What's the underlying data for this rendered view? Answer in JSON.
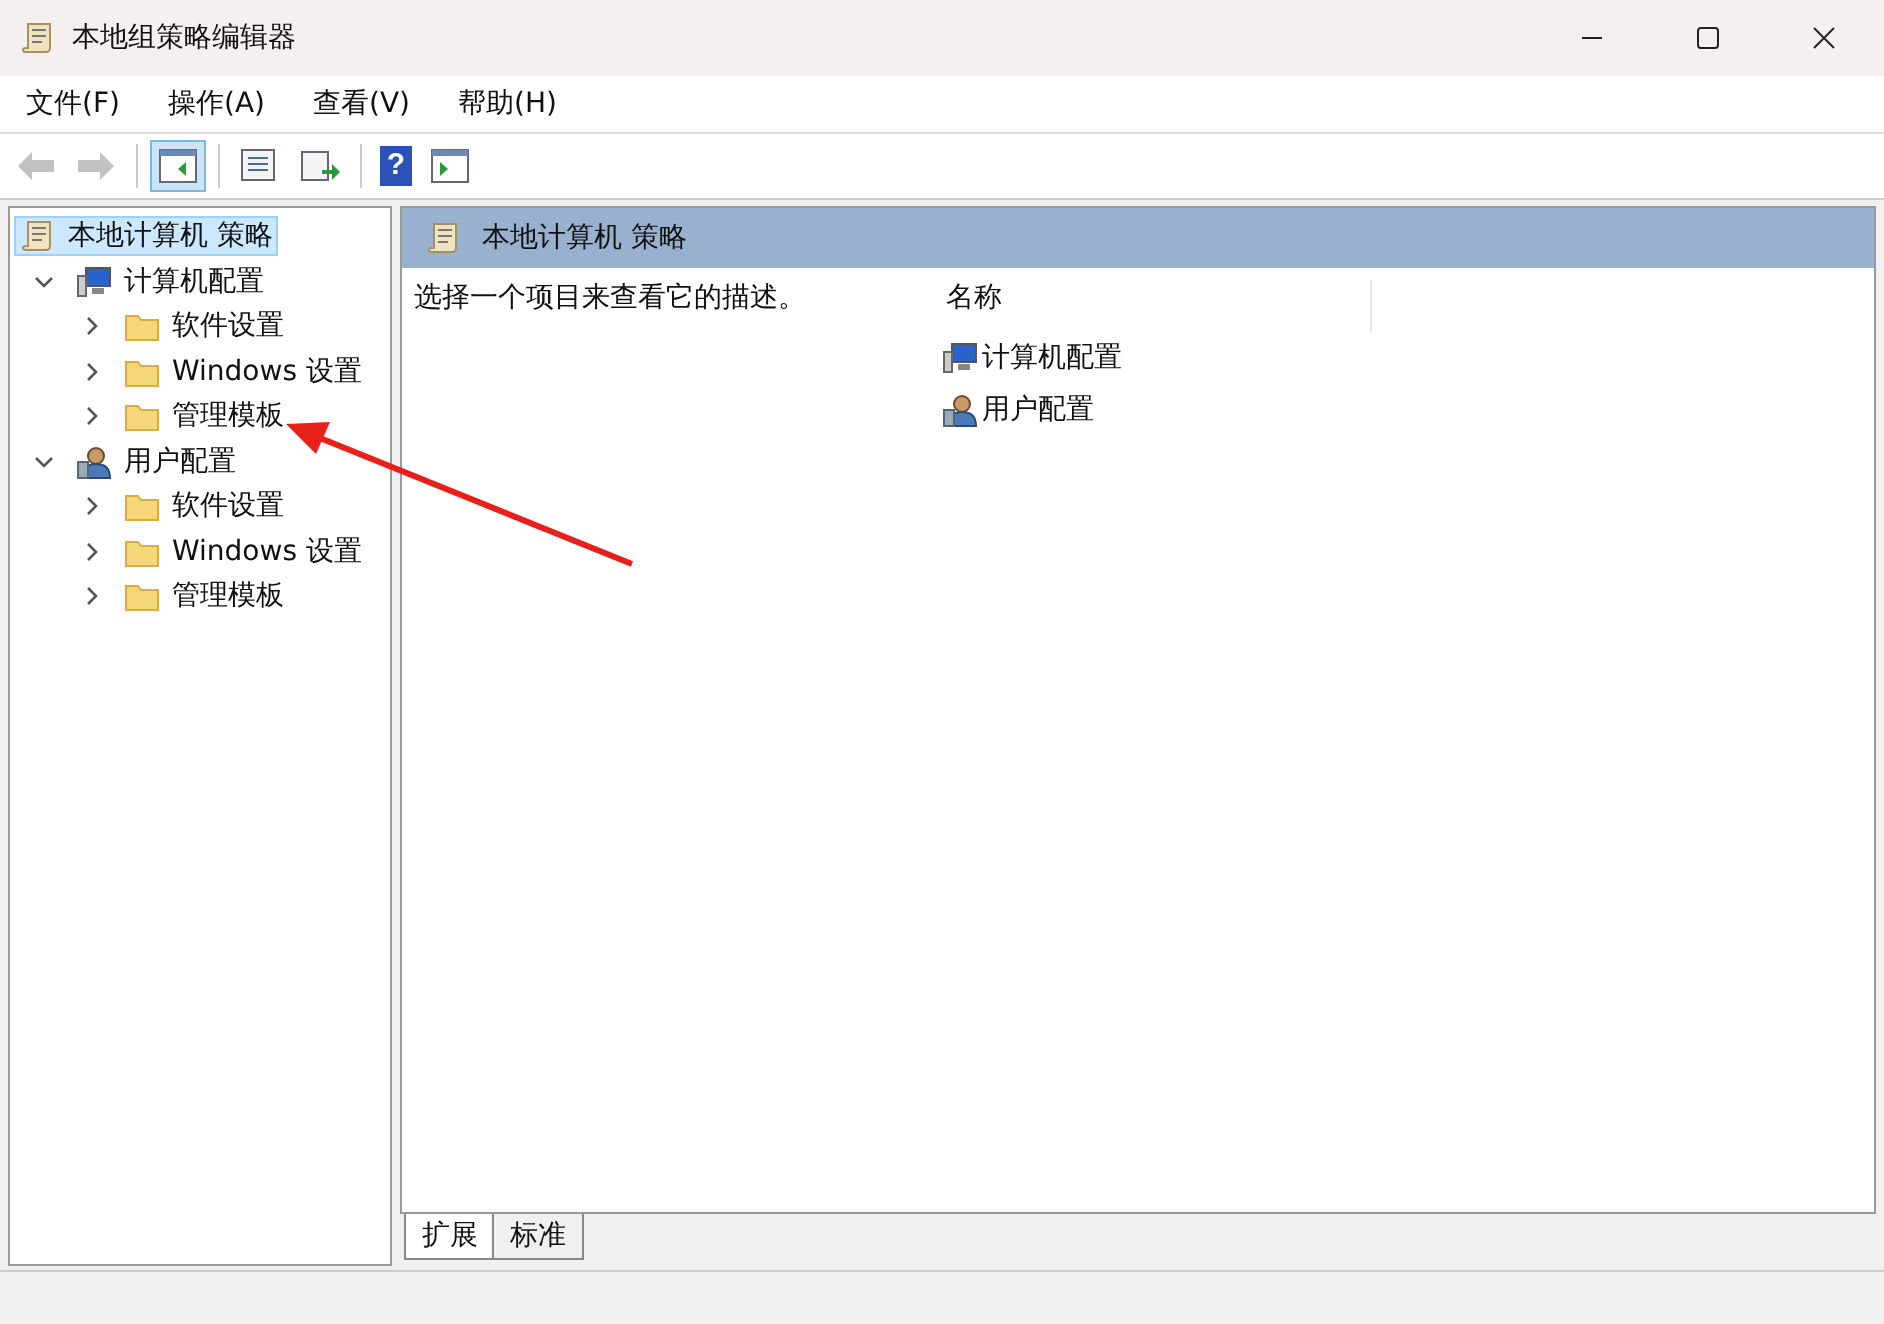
{
  "window": {
    "title": "本地组策略编辑器"
  },
  "menu": [
    "文件(F)",
    "操作(A)",
    "查看(V)",
    "帮助(H)"
  ],
  "toolbar": [
    {
      "kind": "back",
      "on": false,
      "disabled": true
    },
    {
      "kind": "forward",
      "on": false,
      "disabled": true
    },
    {
      "kind": "tree-pane",
      "on": true,
      "disabled": false
    },
    {
      "kind": "properties",
      "on": false,
      "disabled": false
    },
    {
      "kind": "export",
      "on": false,
      "disabled": false
    },
    {
      "kind": "help",
      "glyph": "?",
      "on": false,
      "disabled": false
    },
    {
      "kind": "action-pane",
      "on": false,
      "disabled": false
    }
  ],
  "tree": [
    {
      "label": "本地计算机 策略",
      "kind": "policy",
      "selected": true,
      "children": [
        {
          "label": "计算机配置",
          "kind": "computer",
          "selected": false,
          "expanded": true,
          "children": [
            {
              "label": "软件设置",
              "kind": "folder",
              "selected": false,
              "expanded": false
            },
            {
              "label": "Windows 设置",
              "kind": "folder",
              "selected": false,
              "expanded": false
            },
            {
              "label": "管理模板",
              "kind": "folder",
              "selected": false,
              "expanded": false
            }
          ]
        },
        {
          "label": "用户配置",
          "kind": "user",
          "selected": false,
          "expanded": true,
          "children": [
            {
              "label": "软件设置",
              "kind": "folder",
              "selected": false,
              "expanded": false
            },
            {
              "label": "Windows 设置",
              "kind": "folder",
              "selected": false,
              "expanded": false
            },
            {
              "label": "管理模板",
              "kind": "folder",
              "selected": false,
              "expanded": false
            }
          ]
        }
      ]
    }
  ],
  "details": {
    "title": "本地计算机 策略",
    "description": "选择一个项目来查看它的描述。",
    "column": "名称",
    "items": [
      {
        "label": "计算机配置",
        "kind": "computer"
      },
      {
        "label": "用户配置",
        "kind": "user"
      }
    ]
  },
  "tabs": [
    {
      "label": "扩展",
      "selected": true
    },
    {
      "label": "标准",
      "selected": false
    }
  ]
}
